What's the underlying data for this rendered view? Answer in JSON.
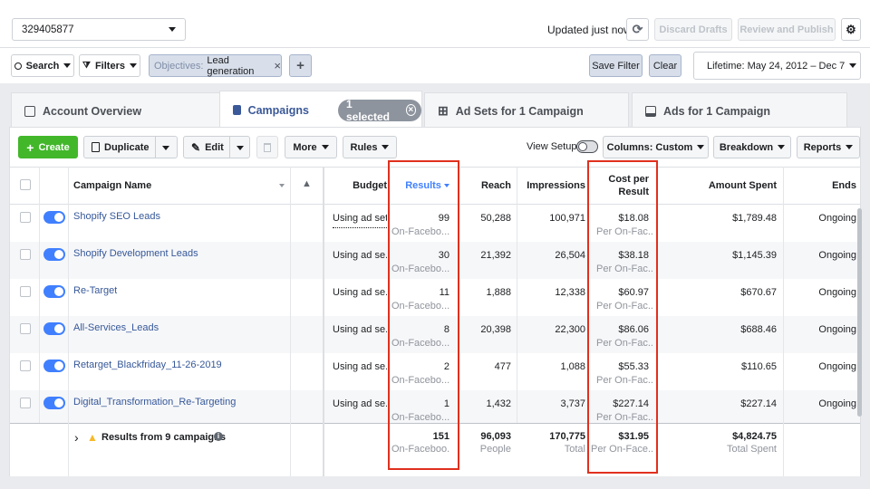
{
  "account": {
    "id": "329405877"
  },
  "top": {
    "updated": "Updated just now",
    "discard": "Discard Drafts",
    "review": "Review and Publish"
  },
  "filterbar": {
    "search": "Search",
    "filters": "Filters",
    "chip_prefix": "Objectives:",
    "chip_value": "Lead generation",
    "save_filter": "Save Filter",
    "clear": "Clear",
    "date": "Lifetime: May 24, 2012 – Dec 7"
  },
  "tabs": {
    "overview": "Account Overview",
    "campaigns": "Campaigns",
    "selected": "1 selected",
    "adsets": "Ad Sets for 1 Campaign",
    "ads": "Ads for 1 Campaign"
  },
  "toolbar": {
    "create": "Create",
    "duplicate": "Duplicate",
    "edit": "Edit",
    "more": "More",
    "rules": "Rules",
    "view_setup": "View Setup",
    "columns_prefix": "Columns:",
    "columns_value": "Custom",
    "breakdown": "Breakdown",
    "reports": "Reports"
  },
  "columns": {
    "name": "Campaign Name",
    "budget": "Budget",
    "results": "Results",
    "reach": "Reach",
    "impressions": "Impressions",
    "cpr_line1": "Cost per",
    "cpr_line2": "Result",
    "spent": "Amount Spent",
    "ends": "Ends"
  },
  "rows": [
    {
      "name": "Shopify SEO Leads",
      "budget": "Using ad set b",
      "results": "99",
      "results_sub": "On-Facebo...",
      "reach": "50,288",
      "impressions": "100,971",
      "cpr": "$18.08",
      "cpr_sub": "Per On-Fac...",
      "spent": "$1,789.48",
      "ends": "Ongoing"
    },
    {
      "name": "Shopify Development Leads",
      "budget": "Using ad se...",
      "results": "30",
      "results_sub": "On-Facebo...",
      "reach": "21,392",
      "impressions": "26,504",
      "cpr": "$38.18",
      "cpr_sub": "Per On-Fac...",
      "spent": "$1,145.39",
      "ends": "Ongoing"
    },
    {
      "name": "Re-Target",
      "budget": "Using ad se...",
      "results": "11",
      "results_sub": "On-Facebo...",
      "reach": "1,888",
      "impressions": "12,338",
      "cpr": "$60.97",
      "cpr_sub": "Per On-Fac...",
      "spent": "$670.67",
      "ends": "Ongoing"
    },
    {
      "name": "All-Services_Leads",
      "budget": "Using ad se...",
      "results": "8",
      "results_sub": "On-Facebo...",
      "reach": "20,398",
      "impressions": "22,300",
      "cpr": "$86.06",
      "cpr_sub": "Per On-Fac...",
      "spent": "$688.46",
      "ends": "Ongoing"
    },
    {
      "name": "Retarget_Blackfriday_11-26-2019",
      "budget": "Using ad se...",
      "results": "2",
      "results_sub": "On-Facebo...",
      "reach": "477",
      "impressions": "1,088",
      "cpr": "$55.33",
      "cpr_sub": "Per On-Fac...",
      "spent": "$110.65",
      "ends": "Ongoing"
    },
    {
      "name": "Digital_Transformation_Re-Targeting",
      "budget": "Using ad se...",
      "results": "1",
      "results_sub": "On-Facebo...",
      "reach": "1,432",
      "impressions": "3,737",
      "cpr": "$227.14",
      "cpr_sub": "Per On-Fac...",
      "spent": "$227.14",
      "ends": "Ongoing"
    }
  ],
  "totals": {
    "label": "Results from 9 campaigns",
    "results": "151",
    "results_sub": "On-Faceboo...",
    "reach": "96,093",
    "reach_sub": "People",
    "impressions": "170,775",
    "impressions_sub": "Total",
    "cpr": "$31.95",
    "cpr_sub": "Per On-Face...",
    "spent": "$4,824.75",
    "spent_sub": "Total Spent"
  },
  "colors": {
    "brand": "#3b5998",
    "create_green": "#42b72a",
    "toggle_blue": "#4080ff",
    "highlight_red": "#e0301e"
  },
  "icons": [
    "refresh-icon",
    "gear-icon",
    "search-icon",
    "filter-icon",
    "close-icon",
    "plus-icon",
    "account-overview-icon",
    "campaigns-folder-icon",
    "adsets-grid-icon",
    "ads-icon",
    "duplicate-icon",
    "pencil-icon",
    "trash-icon",
    "warning-icon",
    "info-icon",
    "chevron-right-icon",
    "sort-desc-icon"
  ]
}
